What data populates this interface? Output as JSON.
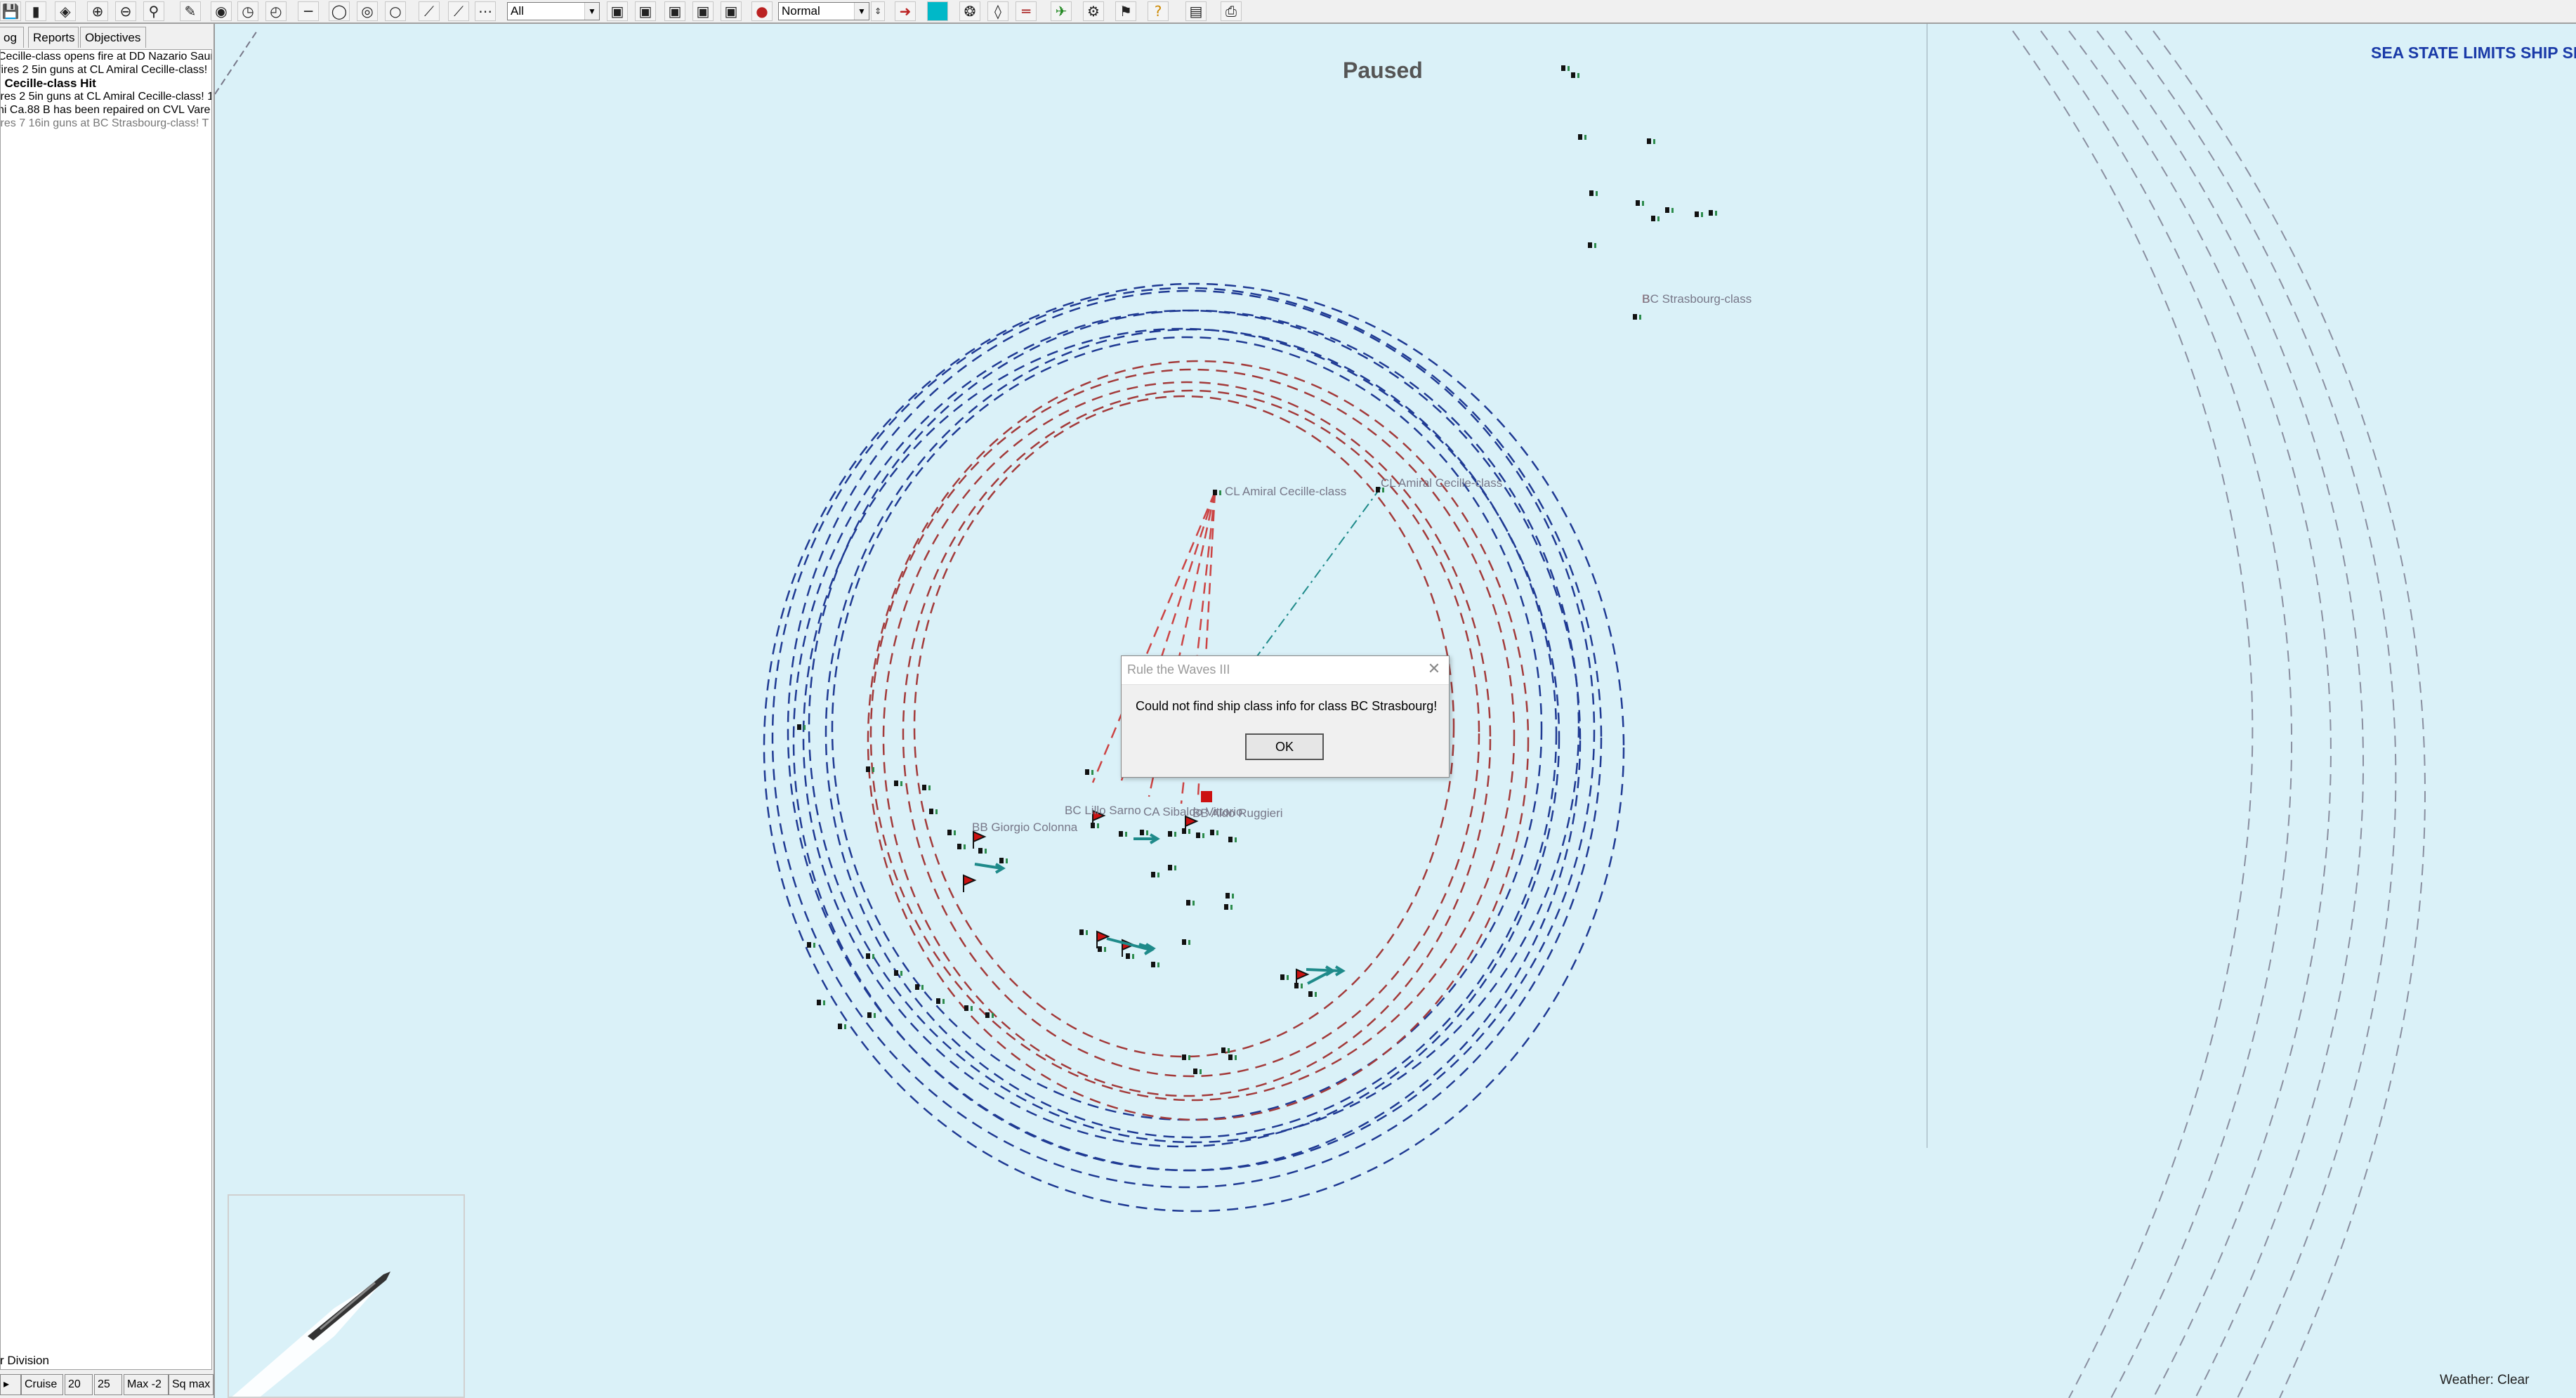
{
  "toolbar": {
    "filter_select": "All",
    "speed_select": "Normal"
  },
  "left_panel": {
    "tabs": [
      "og",
      "Reports",
      "Objectives"
    ],
    "log_lines": [
      {
        "text": "Cecille-class opens fire at DD Nazario Saur",
        "style": "normal"
      },
      {
        "text": "fires 2 5in guns at CL Amiral Cecille-class!",
        "style": "normal"
      },
      {
        "text": "l Cecille-class Hit",
        "style": "bold"
      },
      {
        "text": "ires 2 5in guns at CL Amiral Cecille-class! 1",
        "style": "normal"
      },
      {
        "text": "ni Ca.88 B has been repaired on CVL Vare",
        "style": "normal"
      },
      {
        "text": "ires 7 16in guns at BC Strasbourg-class! T",
        "style": "grey"
      }
    ],
    "division_label": "r Division",
    "speed_buttons": [
      "▸",
      "Cruise",
      "20",
      "25",
      "Max -2",
      "Sq max"
    ]
  },
  "map": {
    "status": "Paused",
    "sea_state": "SEA STATE LIMITS SHIP SF",
    "weather": "Weather: Clear",
    "ship_labels": [
      {
        "text": "BC Strasbourg-class",
        "prefix": "B",
        "prefix_color": "#c0392b"
      },
      {
        "text": "CL Amiral Cecille-class",
        "prefix": "C",
        "prefix_color": "#c0392b"
      },
      {
        "text": "CL Amiral Cecille-class",
        "prefix": "C",
        "prefix_color": "#c0392b"
      },
      {
        "text": "BB Giorgio Colonna",
        "prefix": "",
        "prefix_color": ""
      },
      {
        "text": "BC Lillo Sarno",
        "prefix": "",
        "prefix_color": ""
      },
      {
        "text": "CA Sibaldo Vittorio",
        "prefix": "",
        "prefix_color": ""
      },
      {
        "text": "BB Aldo Ruggieri",
        "prefix": "",
        "prefix_color": ""
      }
    ],
    "colors": {
      "sea": "#daf1f8",
      "blue_range_rings": "#1f3a93",
      "red_range_rings": "#a33a3a",
      "speed_vectors": "#1e8a8a",
      "enemy_flag": "#cc1111"
    },
    "icons": [
      "ship-icon",
      "flag-icon",
      "speed-vector-icon"
    ]
  },
  "dialog": {
    "title": "Rule the Waves III",
    "message": "Could not find ship class info for class BC Strasbourg!",
    "ok_label": "OK",
    "close_icon": "close-icon"
  }
}
